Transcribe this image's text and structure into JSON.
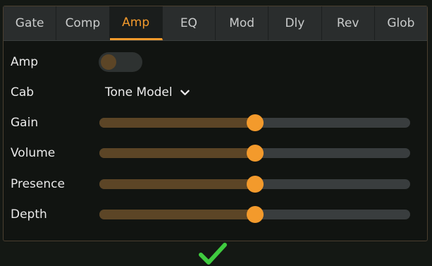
{
  "tabs": [
    {
      "label": "Gate",
      "active": false
    },
    {
      "label": "Comp",
      "active": false
    },
    {
      "label": "Amp",
      "active": true
    },
    {
      "label": "EQ",
      "active": false
    },
    {
      "label": "Mod",
      "active": false
    },
    {
      "label": "Dly",
      "active": false
    },
    {
      "label": "Rev",
      "active": false
    },
    {
      "label": "Glob",
      "active": false
    }
  ],
  "amp": {
    "label": "Amp",
    "enabled": false
  },
  "cab": {
    "label": "Cab",
    "value": "Tone Model",
    "icon": "chevron-down-icon"
  },
  "sliders": [
    {
      "label": "Gain",
      "value": 0.5
    },
    {
      "label": "Volume",
      "value": 0.5
    },
    {
      "label": "Presence",
      "value": 0.5
    },
    {
      "label": "Depth",
      "value": 0.5
    }
  ],
  "confirm": {
    "icon": "checkmark-icon"
  },
  "colors": {
    "accent": "#f39a2c",
    "fill": "#5c4526",
    "track": "#393d3e",
    "tab_bg": "#2a2d2d",
    "check": "#3fcb3f"
  }
}
